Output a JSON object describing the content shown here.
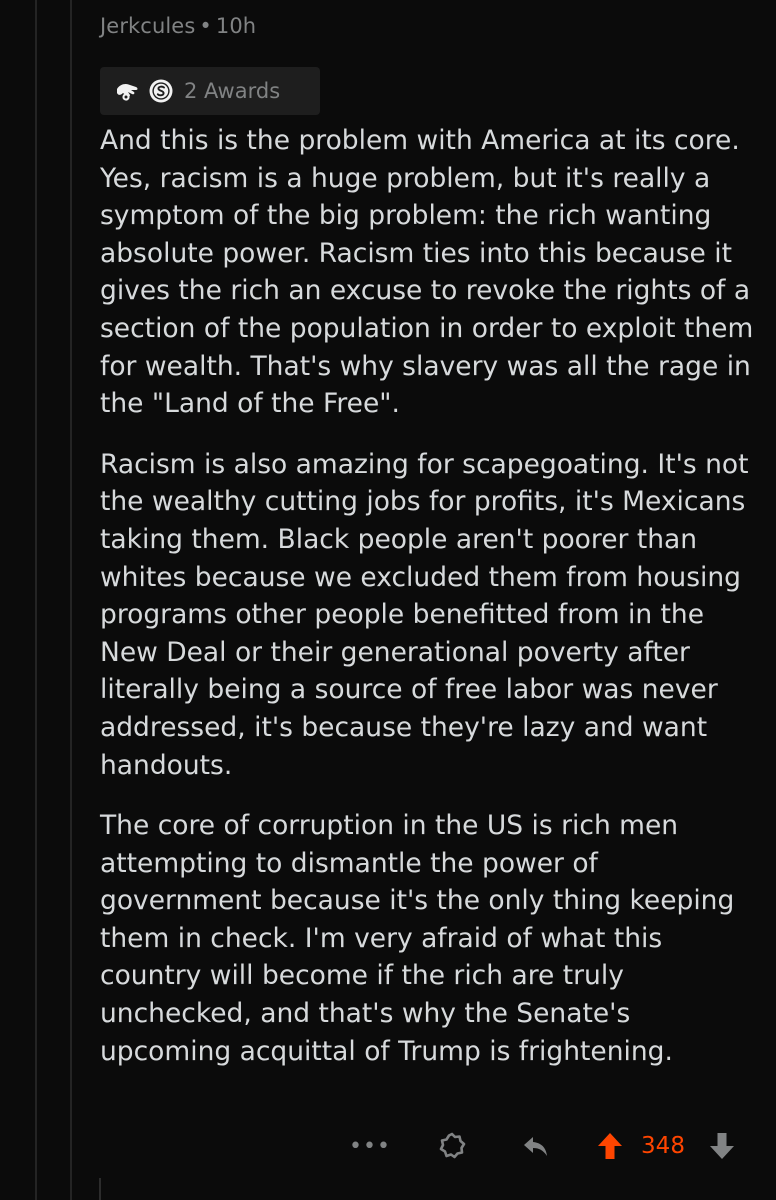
{
  "comment": {
    "author": "Jerkcules",
    "separator": "•",
    "age": "10h",
    "awards": {
      "icons": [
        "wholesome-hand-icon",
        "silver-award-icon"
      ],
      "label": "2 Awards"
    },
    "paragraphs": [
      "And this is the problem with America at its core. Yes, racism is a huge problem, but it's really a symptom of the big problem: the rich wanting absolute power. Racism ties into this because it gives the rich an excuse to revoke the rights of a section of the population in order to exploit them for wealth. That's why slavery was all the rage in the \"Land of the Free\".",
      "Racism is also amazing for scapegoating. It's not the wealthy cutting jobs for profits, it's Mexicans taking them. Black people aren't poorer than whites because we excluded them from housing programs other people benefitted from in the New Deal or their generational poverty after literally being a source of free labor was never addressed, it's because they're lazy and want handouts.",
      "The core of corruption in the US is rich men attempting to dismantle the power of government because it's the only thing keeping them in check. I'm very afraid of what this country will become if the rich are truly unchecked, and that's why the Senate's upcoming acquittal of Trump is frightening."
    ],
    "actions": {
      "more_label": "•••",
      "score": "348"
    }
  },
  "colors": {
    "background": "#0b0b0b",
    "text": "#d7dadc",
    "meta": "#818384",
    "upvote_active": "#ff4500"
  }
}
